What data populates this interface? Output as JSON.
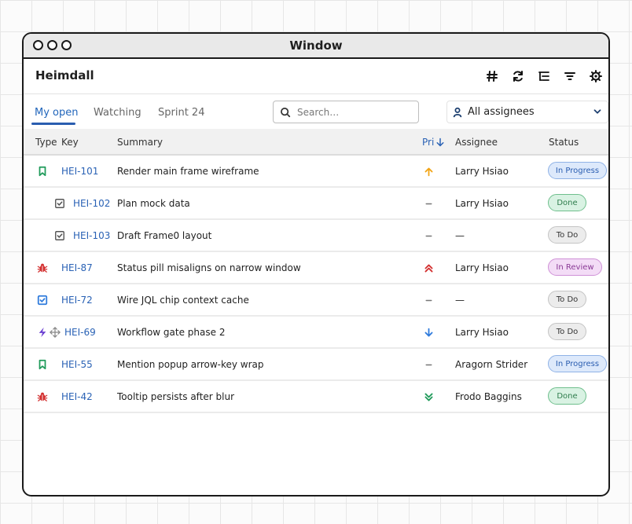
{
  "window": {
    "title": "Window"
  },
  "app": {
    "name": "Heimdall"
  },
  "toolbar": {
    "icons": [
      "hash-icon",
      "refresh-icon",
      "list-tree-icon",
      "filter-icon",
      "settings-icon"
    ]
  },
  "tabs": [
    {
      "label": "My open",
      "active": true
    },
    {
      "label": "Watching",
      "active": false
    },
    {
      "label": "Sprint 24",
      "active": false
    }
  ],
  "search": {
    "placeholder": "Search…",
    "value": ""
  },
  "assignee_filter": {
    "label": "All assignees"
  },
  "columns": {
    "type": "Type",
    "key": "Key",
    "summary": "Summary",
    "priority": "Pri",
    "assignee": "Assignee",
    "status": "Status"
  },
  "colors": {
    "accent": "#2a5db0",
    "story": "#1f9a5a",
    "bug": "#d32f2f",
    "epic": "#6a3fd1",
    "task": "#2f7bdc"
  },
  "issues": [
    {
      "type": "story-icon",
      "key": "HEI-101",
      "summary": "Render main frame wireframe",
      "priority": "high",
      "assignee": "Larry Hsiao",
      "status": "In Progress",
      "indent": 0
    },
    {
      "type": "subtask-icon",
      "key": "HEI-102",
      "summary": "Plan mock data",
      "priority": "none",
      "assignee": "Larry Hsiao",
      "status": "Done",
      "indent": 1
    },
    {
      "type": "subtask-icon",
      "key": "HEI-103",
      "summary": "Draft Frame0 layout",
      "priority": "none",
      "assignee": "—",
      "status": "To Do",
      "indent": 1
    },
    {
      "type": "bug-icon",
      "key": "HEI-87",
      "summary": "Status pill misaligns on narrow window",
      "priority": "highest",
      "assignee": "Larry Hsiao",
      "status": "In Review",
      "indent": 0
    },
    {
      "type": "task-icon",
      "key": "HEI-72",
      "summary": "Wire JQL chip context cache",
      "priority": "none",
      "assignee": "—",
      "status": "To Do",
      "indent": 0
    },
    {
      "type": "epic-icon",
      "key": "HEI-69",
      "summary": "Workflow gate phase 2",
      "priority": "low",
      "assignee": "Larry Hsiao",
      "status": "To Do",
      "indent": 0
    },
    {
      "type": "story-icon",
      "key": "HEI-55",
      "summary": "Mention popup arrow-key wrap",
      "priority": "none",
      "assignee": "Aragorn Strider",
      "status": "In Progress",
      "indent": 0
    },
    {
      "type": "bug-icon",
      "key": "HEI-42",
      "summary": "Tooltip persists after blur",
      "priority": "lowest",
      "assignee": "Frodo Baggins",
      "status": "Done",
      "indent": 0
    }
  ]
}
